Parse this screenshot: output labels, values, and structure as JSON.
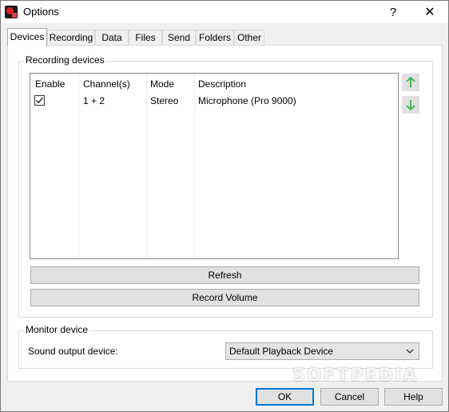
{
  "window": {
    "title": "Options",
    "help_glyph": "?",
    "close_glyph": "✕"
  },
  "tabs": [
    {
      "label": "Devices",
      "active": true
    },
    {
      "label": "Recording"
    },
    {
      "label": "Data"
    },
    {
      "label": "Files"
    },
    {
      "label": "Send"
    },
    {
      "label": "Folders"
    },
    {
      "label": "Other"
    }
  ],
  "recording_devices": {
    "group_label": "Recording devices",
    "columns": [
      "Enable",
      "Channel(s)",
      "Mode",
      "Description"
    ],
    "rows": [
      {
        "enabled": true,
        "channels": "1 + 2",
        "mode": "Stereo",
        "description": "Microphone (Pro 9000)"
      }
    ],
    "move_up_icon": "arrow-up-icon",
    "move_down_icon": "arrow-down-icon",
    "refresh_label": "Refresh",
    "record_volume_label": "Record Volume"
  },
  "monitor_device": {
    "group_label": "Monitor device",
    "sound_output_label": "Sound output device:",
    "sound_output_value": "Default Playback Device"
  },
  "footer": {
    "ok_label": "OK",
    "cancel_label": "Cancel",
    "help_label": "Help"
  },
  "watermark": "SOFTPEDIA",
  "colors": {
    "accent": "#0078d7",
    "arrow_green": "#3cb44b"
  }
}
